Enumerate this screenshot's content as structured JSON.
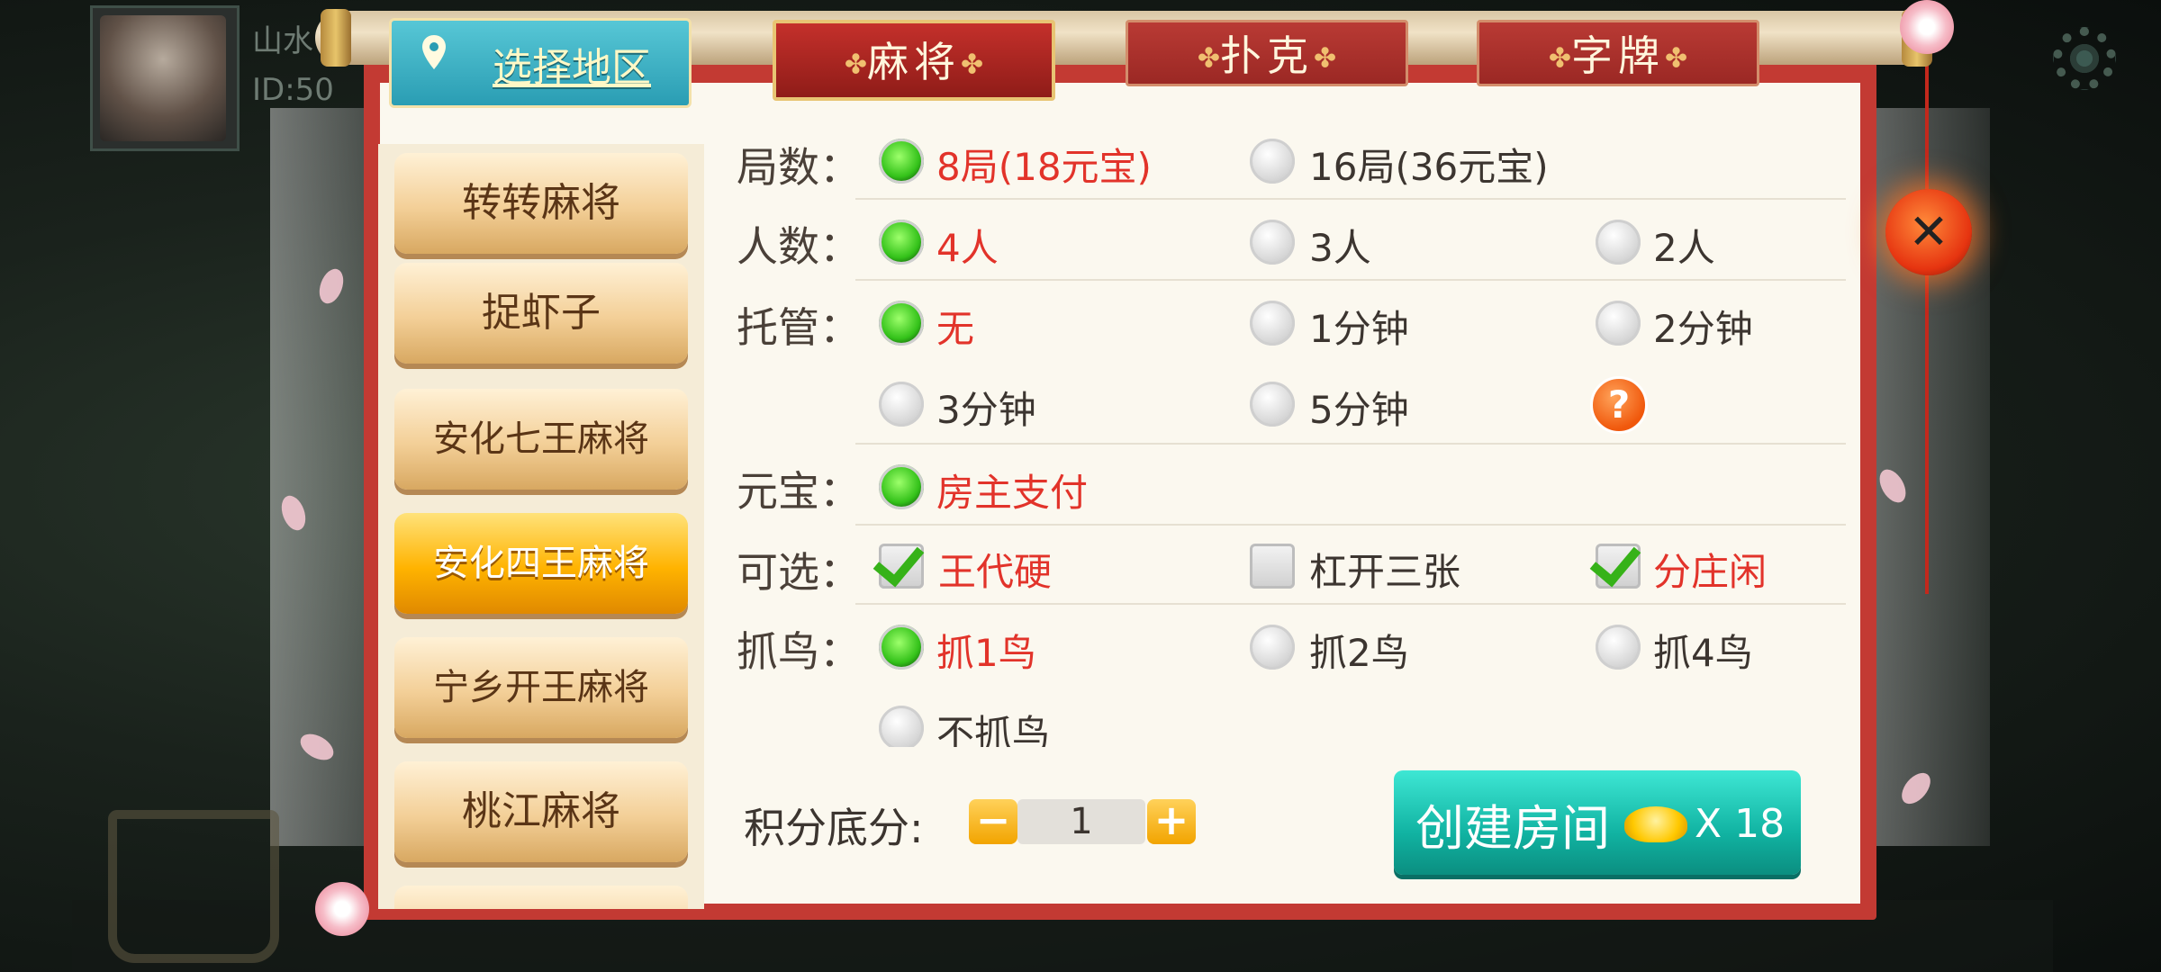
{
  "player": {
    "name": "山水",
    "id": "ID:50"
  },
  "region": {
    "label": "选择地区"
  },
  "tabs": [
    {
      "label": "麻将",
      "active": true
    },
    {
      "label": "扑克",
      "active": false
    },
    {
      "label": "字牌",
      "active": false
    }
  ],
  "games": [
    {
      "label": "转转麻将",
      "selected": false
    },
    {
      "label": "捉虾子",
      "selected": false
    },
    {
      "label": "安化七王麻将",
      "selected": false
    },
    {
      "label": "安化四王麻将",
      "selected": true
    },
    {
      "label": "宁乡开王麻将",
      "selected": false
    },
    {
      "label": "桃江麻将",
      "selected": false
    }
  ],
  "options": {
    "rounds": {
      "label": "局数：",
      "choices": [
        {
          "text": "8局(18元宝)",
          "checked": true
        },
        {
          "text": "16局(36元宝)",
          "checked": false
        }
      ]
    },
    "players": {
      "label": "人数：",
      "choices": [
        {
          "text": "4人",
          "checked": true
        },
        {
          "text": "3人",
          "checked": false
        },
        {
          "text": "2人",
          "checked": false
        }
      ]
    },
    "trustee": {
      "label": "托管：",
      "choices": [
        {
          "text": "无",
          "checked": true
        },
        {
          "text": "1分钟",
          "checked": false
        },
        {
          "text": "2分钟",
          "checked": false
        },
        {
          "text": "3分钟",
          "checked": false
        },
        {
          "text": "5分钟",
          "checked": false
        }
      ]
    },
    "ingot": {
      "label": "元宝：",
      "choices": [
        {
          "text": "房主支付",
          "checked": true
        }
      ]
    },
    "optional": {
      "label": "可选：",
      "choices": [
        {
          "text": "王代硬",
          "checked": true
        },
        {
          "text": "杠开三张",
          "checked": false
        },
        {
          "text": "分庄闲",
          "checked": true
        }
      ]
    },
    "bird": {
      "label": "抓鸟：",
      "choices": [
        {
          "text": "抓1鸟",
          "checked": true
        },
        {
          "text": "抓2鸟",
          "checked": false
        },
        {
          "text": "抓4鸟",
          "checked": false
        },
        {
          "text": "不抓鸟",
          "checked": false
        }
      ]
    }
  },
  "help_symbol": "?",
  "score": {
    "label": "积分底分:",
    "value": "1",
    "minus": "−",
    "plus": "+"
  },
  "create": {
    "label": "创建房间",
    "cost": "X 18"
  },
  "close_symbol": "✕",
  "colors": {
    "accent_red": "#e2332a",
    "frame_red": "#c33a33",
    "create_teal": "#11b3a2",
    "selected_gold": "#ffb300",
    "radio_green": "#34c21a"
  }
}
